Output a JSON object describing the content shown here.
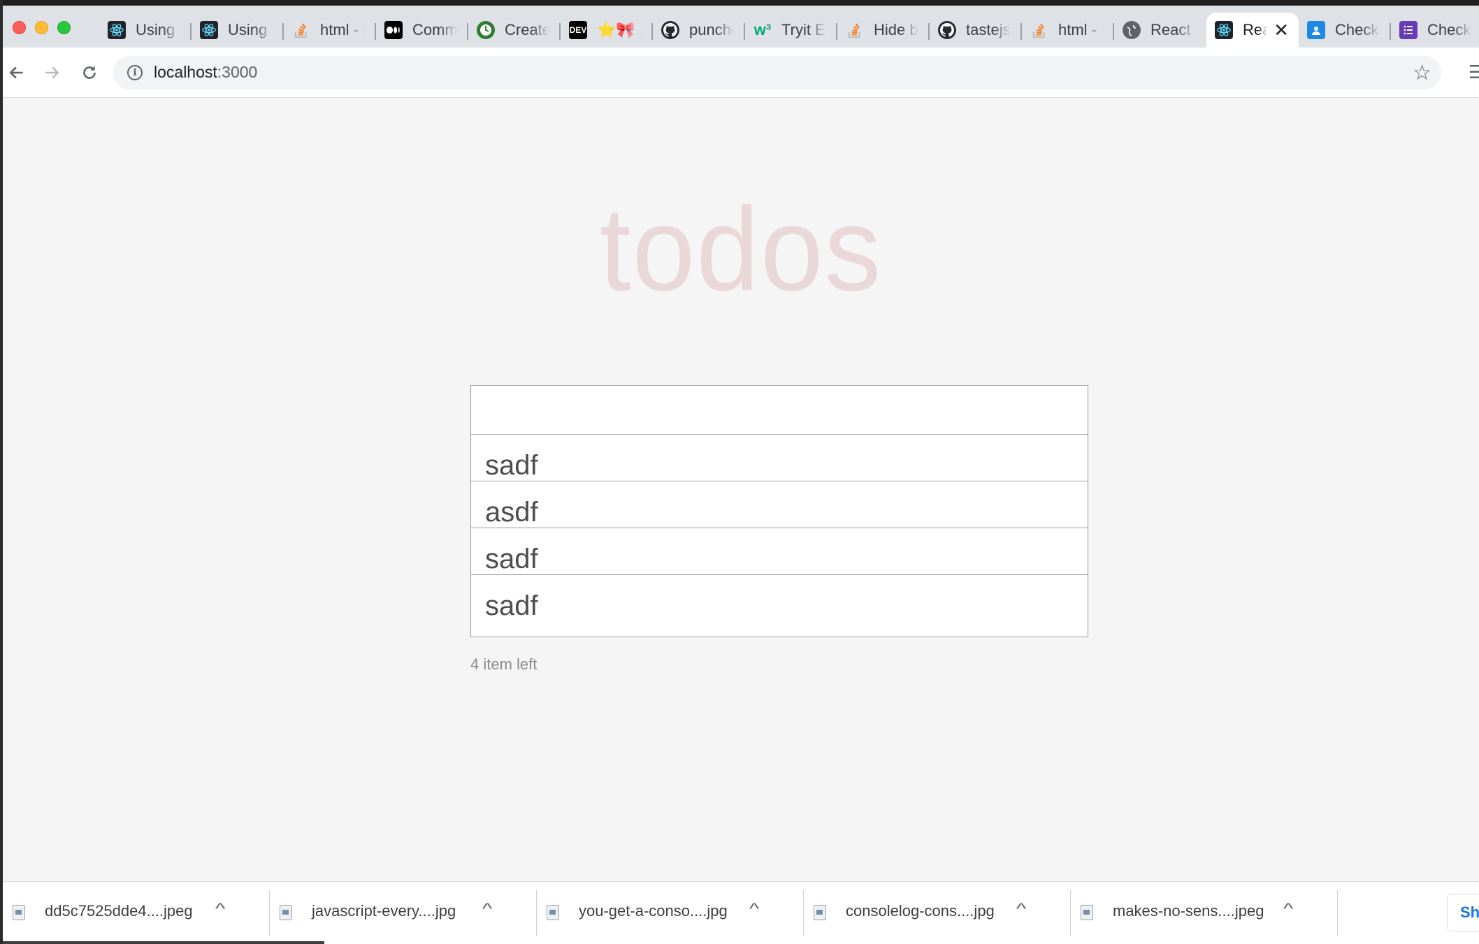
{
  "browser": {
    "tabs": [
      {
        "title": "Using t",
        "icon": "react-icon"
      },
      {
        "title": "Using t",
        "icon": "react-icon"
      },
      {
        "title": "html - E",
        "icon": "stackoverflow-icon"
      },
      {
        "title": "Commo",
        "icon": "medium-icon"
      },
      {
        "title": "Create",
        "icon": "create-icon"
      },
      {
        "title": "⭐🎀 J",
        "icon": "dev-icon"
      },
      {
        "title": "puncho",
        "icon": "github-icon"
      },
      {
        "title": "Tryit Ed",
        "icon": "w3schools-icon"
      },
      {
        "title": "Hide bo",
        "icon": "stackoverflow-icon"
      },
      {
        "title": "tastejs/",
        "icon": "github-icon"
      },
      {
        "title": "html - E",
        "icon": "stackoverflow-icon"
      },
      {
        "title": "React -",
        "icon": "globe-icon"
      },
      {
        "title": "Rea",
        "icon": "react-icon",
        "active": true
      },
      {
        "title": "Checki",
        "icon": "classroom-icon"
      },
      {
        "title": "Checki",
        "icon": "forms-icon"
      }
    ],
    "favicon_text": {
      "dev": "DEV",
      "w3": "w³"
    },
    "address": {
      "host": "localhost",
      "port": ":3000"
    }
  },
  "app": {
    "title": "todos",
    "new_todo_value": "",
    "todos": [
      "sadf",
      "asdf",
      "sadf",
      "sadf"
    ],
    "count_text": "4 item left"
  },
  "downloads": {
    "items": [
      "dd5c7525dde4....jpeg",
      "javascript-every....jpg",
      "you-get-a-conso....jpg",
      "consolelog-cons....jpg",
      "makes-no-sens....jpeg"
    ],
    "show_all_label": "Sh"
  }
}
